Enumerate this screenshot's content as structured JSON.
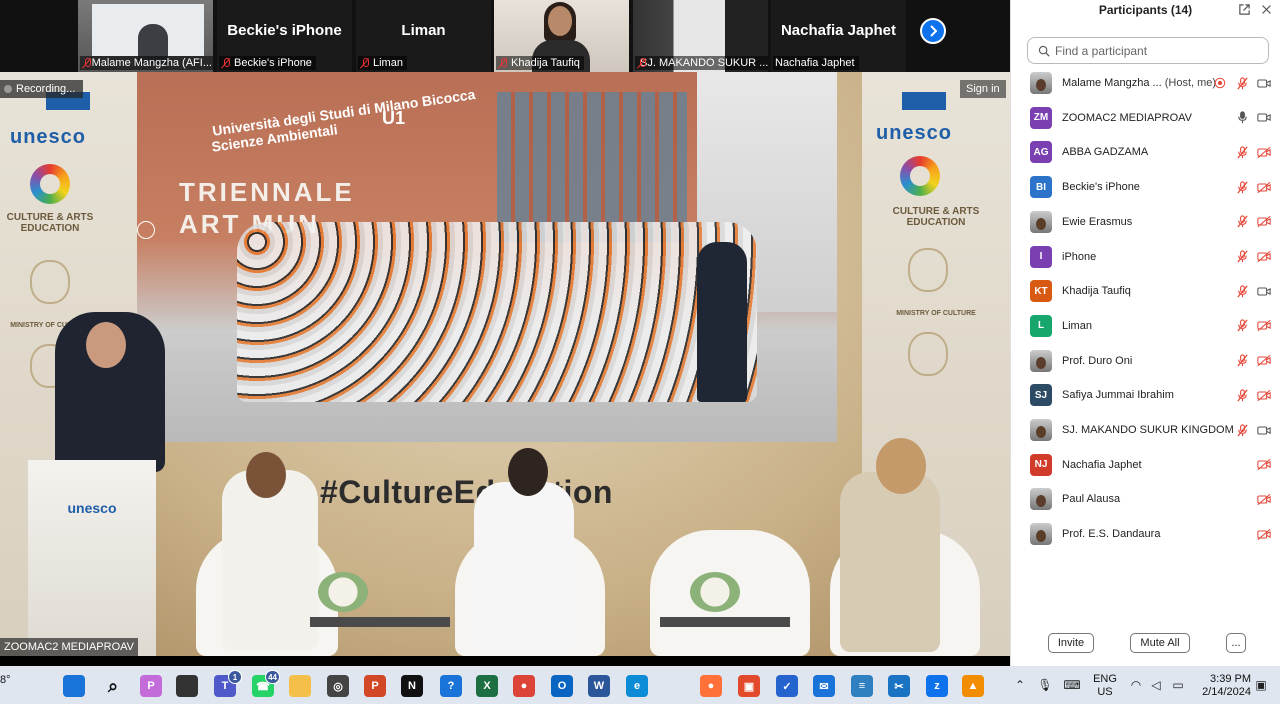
{
  "thumbnails": [
    {
      "caption": "Malame Mangzha (AFI..."
    },
    {
      "big_name": "Beckie's iPhone",
      "caption": "Beckie's iPhone"
    },
    {
      "big_name": "Liman",
      "caption": "Liman"
    },
    {
      "caption": "Khadija Taufiq"
    },
    {
      "caption": "SJ. MAKANDO SUKUR ..."
    },
    {
      "big_name": "Nachafia Japhet",
      "caption": "Nachafia Japhet"
    }
  ],
  "stage": {
    "recording_label": "Recording...",
    "signin_label": "Sign in",
    "active_speaker": "ZOOMAC2 MEDIAPROAV",
    "hashtag": "#CultureEducation",
    "screen_text": {
      "university": "Università degli Studi di Milano Bicocca",
      "faculty": "Scienze Ambientali",
      "block": "U1",
      "banner": "TRIENNALE ART MUN"
    },
    "unesco": "unesco",
    "banner_subtitle": "CULTURE & ARTS EDUCATION",
    "ministry": "MINISTRY OF CULTURE"
  },
  "participants_panel": {
    "title": "Participants (14)",
    "search_placeholder": "Find a participant",
    "invite_label": "Invite",
    "mute_all_label": "Mute All",
    "more_label": "...",
    "participants": [
      {
        "name": "Malame Mangzha ...",
        "tag": "(Host, me)",
        "avatar": "photo",
        "mic": "muted",
        "video": "on",
        "recording": true
      },
      {
        "name": "ZOOMAC2 MEDIAPROAV",
        "initials": "ZM",
        "color": "#7a3fb0",
        "mic": "on",
        "video": "on"
      },
      {
        "name": "ABBA GADZAMA",
        "initials": "AG",
        "color": "#7a3fb0",
        "mic": "muted",
        "video": "off"
      },
      {
        "name": "Beckie's iPhone",
        "initials": "BI",
        "color": "#2b74c9",
        "mic": "muted",
        "video": "off"
      },
      {
        "name": "Ewie Erasmus",
        "avatar": "photo",
        "mic": "muted",
        "video": "off"
      },
      {
        "name": "iPhone",
        "initials": "I",
        "color": "#7a3fb0",
        "mic": "muted",
        "video": "off"
      },
      {
        "name": "Khadija Taufiq",
        "initials": "KT",
        "color": "#d85a12",
        "mic": "muted",
        "video": "on"
      },
      {
        "name": "Liman",
        "initials": "L",
        "color": "#17a66b",
        "mic": "muted",
        "video": "off"
      },
      {
        "name": "Prof. Duro Oni",
        "avatar": "photo",
        "mic": "muted",
        "video": "off"
      },
      {
        "name": "Safiya Jummai Ibrahim",
        "initials": "SJ",
        "color": "#2e4b66",
        "mic": "muted",
        "video": "off"
      },
      {
        "name": "SJ. MAKANDO SUKUR KINGDOM",
        "avatar": "photo",
        "mic": "muted",
        "video": "on"
      },
      {
        "name": "Nachafia Japhet",
        "initials": "NJ",
        "color": "#d13b2a",
        "mic": "none",
        "video": "off"
      },
      {
        "name": "Paul Alausa",
        "avatar": "photo",
        "mic": "none",
        "video": "off"
      },
      {
        "name": "Prof. E.S. Dandaura",
        "avatar": "photo",
        "mic": "none",
        "video": "off"
      }
    ]
  },
  "taskbar": {
    "weather_fragment": "8°",
    "teams_badge": "1",
    "whatsapp_badge": "44",
    "language": "ENG",
    "region": "US",
    "time": "3:39 PM",
    "date": "2/14/2024",
    "apps": [
      "start-icon",
      "search-icon",
      "copilot-icon",
      "taskview-icon",
      "teams-icon",
      "whatsapp-icon",
      "file-explorer-icon",
      "camera-app-icon",
      "powerpoint-icon",
      "netflix-icon",
      "help-icon",
      "excel-icon",
      "chrome-icon",
      "outlook-icon",
      "word-icon",
      "edge-icon",
      "firefox-icon",
      "shop-icon",
      "todo-icon",
      "mail-icon",
      "notepad-icon",
      "snipping-icon",
      "zoom-icon",
      "vlc-icon"
    ]
  },
  "colors": {
    "accent": "#0e72ed",
    "muted_red": "#e5483a",
    "stage_bg": "#c9b184"
  }
}
